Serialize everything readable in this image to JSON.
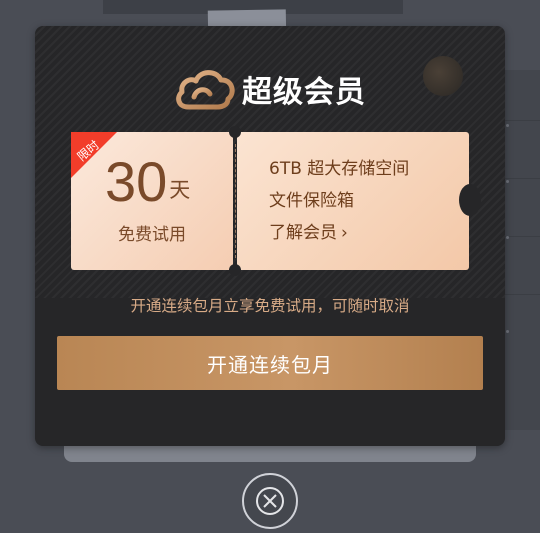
{
  "modal": {
    "title": "超级会员",
    "logo_icon": "cloud-icon",
    "ticket": {
      "badge": "限时",
      "days_value": "30",
      "days_unit": "天",
      "trial_label": "免费试用",
      "benefits": [
        "6TB 超大存储空间",
        "文件保险箱"
      ],
      "learn_more": "了解会员",
      "learn_more_icon": "chevron-right-icon"
    },
    "subtitle": "开通连续包月立享免费试用，可随时取消",
    "subscribe_button": "开通连续包月",
    "close_icon": "close-icon"
  },
  "colors": {
    "modal_bg": "#262628",
    "accent_gold": "#c08c5c",
    "ticket_text": "#7a4a2a",
    "badge_red": "#f23d2a"
  }
}
